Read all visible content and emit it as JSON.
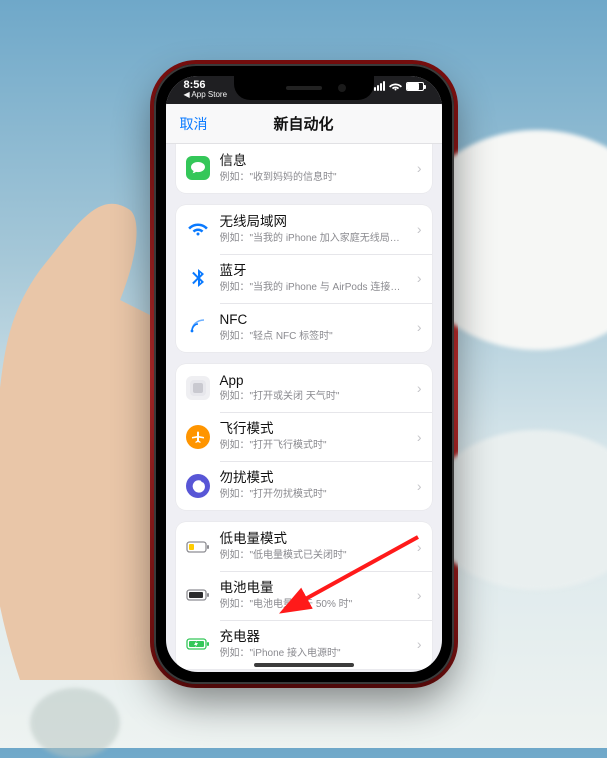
{
  "status": {
    "time": "8:56",
    "back": "◀ App Store"
  },
  "nav": {
    "cancel": "取消",
    "title": "新自动化"
  },
  "groups": [
    {
      "rows": [
        {
          "icon": "message-icon",
          "title": "信息",
          "sub": "例如：\"收到妈妈的信息时\""
        }
      ]
    },
    {
      "rows": [
        {
          "icon": "wifi-icon",
          "title": "无线局域网",
          "sub": "例如：\"当我的 iPhone 加入家庭无线局域网时\""
        },
        {
          "icon": "bluetooth-icon",
          "title": "蓝牙",
          "sub": "例如：\"当我的 iPhone 与 AirPods 连接时\""
        },
        {
          "icon": "nfc-icon",
          "title": "NFC",
          "sub": "例如：\"轻点 NFC 标签时\""
        }
      ]
    },
    {
      "rows": [
        {
          "icon": "app-icon",
          "title": "App",
          "sub": "例如：\"打开或关闭 天气时\""
        },
        {
          "icon": "airplane-icon",
          "title": "飞行模式",
          "sub": "例如：\"打开飞行模式时\""
        },
        {
          "icon": "dnd-icon",
          "title": "勿扰模式",
          "sub": "例如：\"打开勿扰模式时\""
        }
      ]
    },
    {
      "rows": [
        {
          "icon": "lowpower-icon",
          "title": "低电量模式",
          "sub": "例如：\"低电量模式已关闭时\""
        },
        {
          "icon": "battery-icon",
          "title": "电池电量",
          "sub": "例如：\"电池电量低于 50% 时\""
        },
        {
          "icon": "charger-icon",
          "title": "充电器",
          "sub": "例如：\"iPhone 接入电源时\""
        }
      ]
    }
  ]
}
